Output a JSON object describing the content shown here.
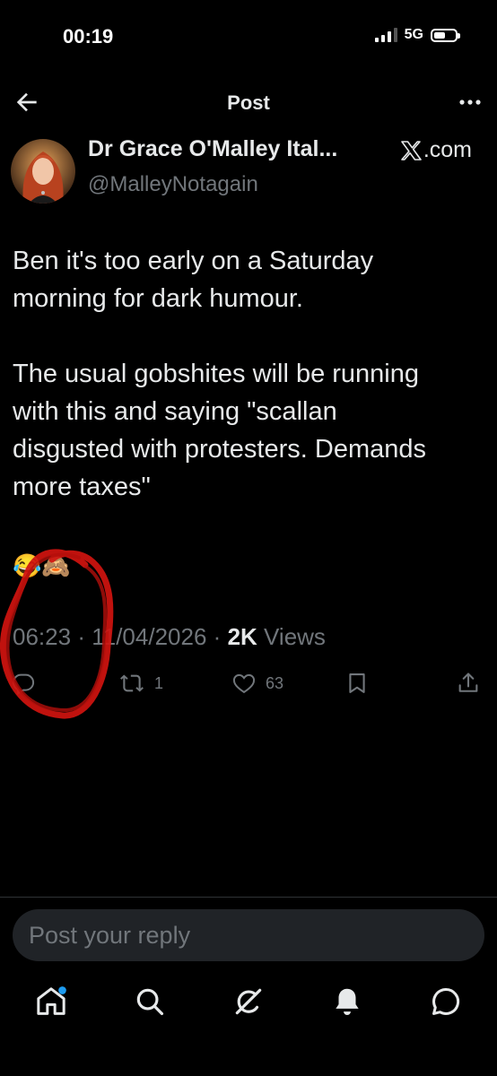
{
  "status_bar": {
    "time": "00:19",
    "network": "5G",
    "signal_bars": 3,
    "signal_bars_total": 4,
    "battery_level": 0.55
  },
  "header": {
    "title": "Post",
    "back_icon": "arrow-left-icon",
    "more_icon": "more-horizontal-icon"
  },
  "post": {
    "author_name": "Dr Grace O'Malley Ital...",
    "author_handle": "@MalleyNotagain",
    "source_label": ".com",
    "source_logo": "x-logo",
    "text": "Ben it's too early on a Saturday\nmorning for dark humour.\n\nThe usual gobshites will be running\nwith this and saying \"scallan\ndisgusted with protesters. Demands\nmore taxes\"",
    "emojis": "😂🙈",
    "time": "06:23",
    "date": "11/04/2026",
    "views_count": "2K",
    "views_label": "Views",
    "separator": "·"
  },
  "actions": {
    "reply_icon": "comment-icon",
    "repost_icon": "repost-icon",
    "repost_count": "1",
    "like_icon": "heart-icon",
    "like_count": "63",
    "bookmark_icon": "bookmark-icon",
    "share_icon": "share-icon"
  },
  "reply_box": {
    "placeholder": "Post your reply"
  },
  "tab_bar": {
    "items": [
      "home-icon",
      "search-icon",
      "grok-icon",
      "notifications-icon",
      "messages-icon"
    ]
  },
  "colors": {
    "background": "#000000",
    "text_primary": "#e7e9ea",
    "text_secondary": "#71767b",
    "accent": "#1d9bf0",
    "annotation": "#d0140f"
  }
}
